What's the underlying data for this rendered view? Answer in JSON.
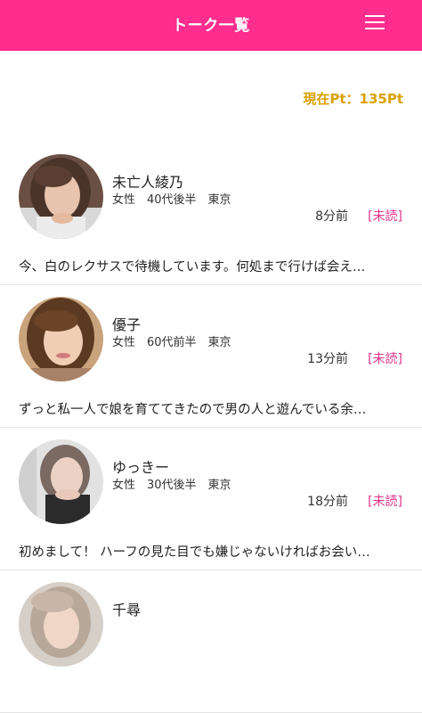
{
  "header": {
    "title": "トーク一覧",
    "background_color": "#ff2d8d",
    "menu_icon": "hamburger-menu-icon"
  },
  "points": {
    "text": "現在Pt：135Pt",
    "color": "#d9a100"
  },
  "talks": [
    {
      "name": "未亡人綾乃",
      "profile": "女性　40代後半　東京",
      "time": "8分前",
      "status": "[未読]",
      "message": "今、白のレクサスで待機しています。何処まで行けば会え…"
    },
    {
      "name": "優子",
      "profile": "女性　60代前半　東京",
      "time": "13分前",
      "status": "[未読]",
      "message": "ずっと私一人で娘を育ててきたので男の人と遊んでいる余…"
    },
    {
      "name": "ゆっきー",
      "profile": "女性　30代後半　東京",
      "time": "18分前",
      "status": "[未読]",
      "message": "初めまして！ ハーフの見た目でも嫌じゃないければお会い…"
    },
    {
      "name": "千尋",
      "profile": "",
      "time": "",
      "status": "",
      "message": ""
    }
  ],
  "colors": {
    "unread": "#e0338a",
    "divider": "#e4e4e4"
  }
}
